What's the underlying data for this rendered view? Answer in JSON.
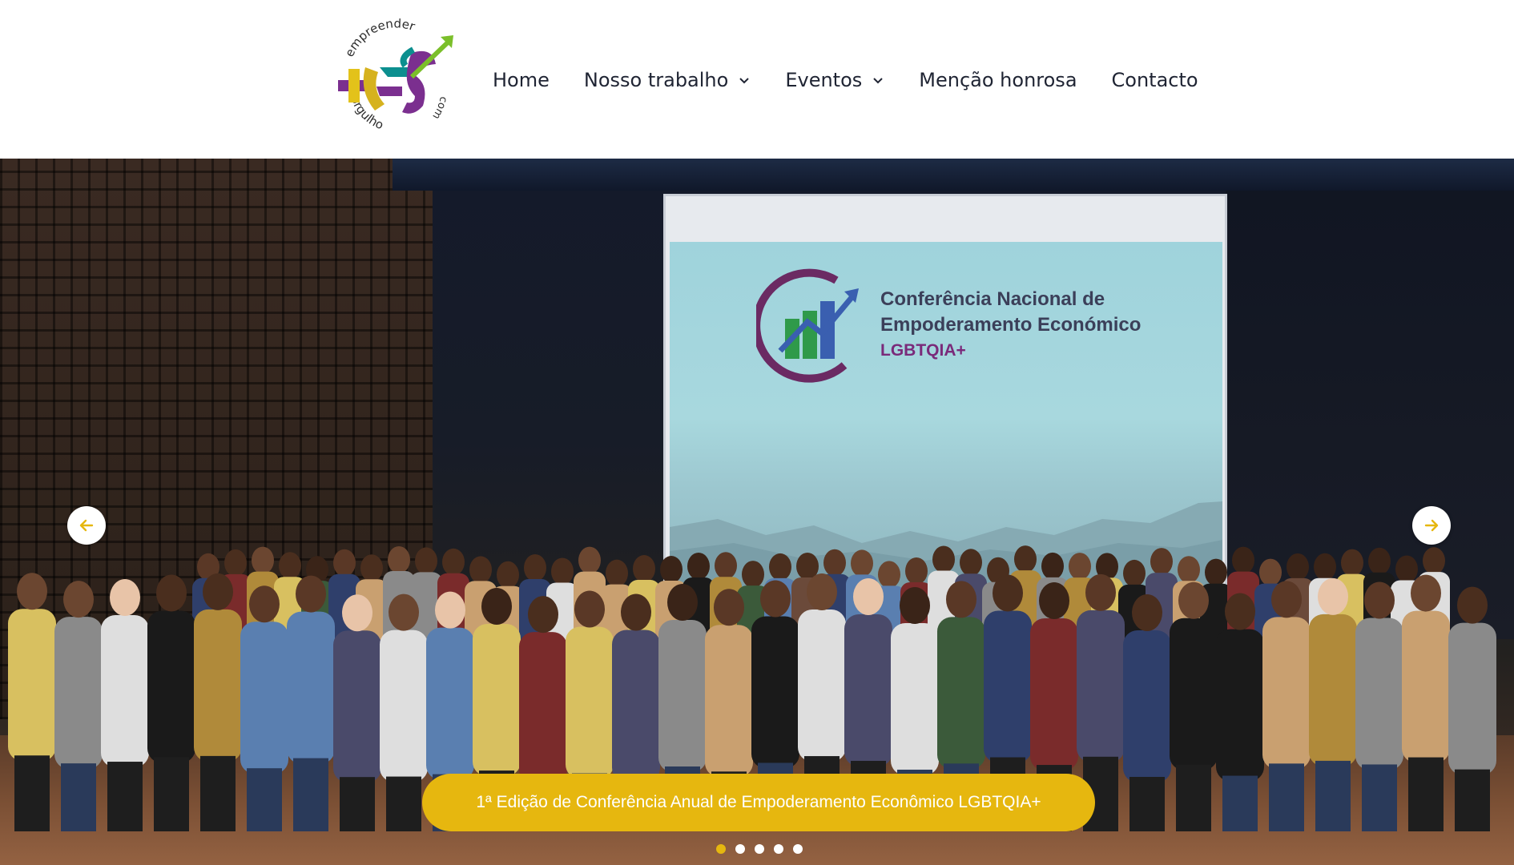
{
  "header": {
    "logo": {
      "top_text": "empreender",
      "right_text": "com",
      "bottom_text": "orgulho"
    },
    "nav": [
      {
        "label": "Home",
        "has_dropdown": false
      },
      {
        "label": "Nosso trabalho",
        "has_dropdown": true
      },
      {
        "label": "Eventos",
        "has_dropdown": true
      },
      {
        "label": "Menção honrosa",
        "has_dropdown": false
      },
      {
        "label": "Contacto",
        "has_dropdown": false
      }
    ]
  },
  "hero": {
    "screen_text": {
      "line1": "Conferência Nacional de",
      "line2": "Empoderamento Económico",
      "line3": "LGBTQIA+"
    },
    "caption": "1ª Edição de Conferência Anual de Empoderamento Econômico LGBTQIA+",
    "slide_count": 5,
    "active_slide": 1,
    "arrow_prev_icon": "arrow-left-icon",
    "arrow_next_icon": "arrow-right-icon"
  },
  "colors": {
    "accent": "#e6b70f",
    "nav_text": "#1f2433"
  }
}
